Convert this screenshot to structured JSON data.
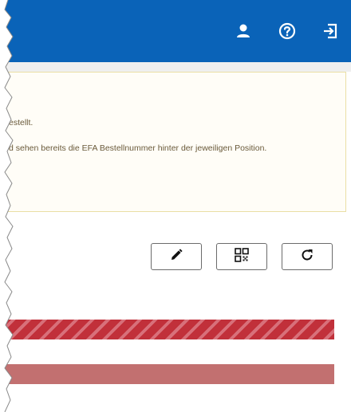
{
  "header": {
    "background": "#0a63b8",
    "icons": [
      "user-icon",
      "help-icon",
      "logout-icon"
    ]
  },
  "info_panel": {
    "line1": "estellt.",
    "line2": "d sehen bereits die EFA Bestellnummer hinter der jeweiligen Position."
  },
  "toolbar": {
    "buttons": [
      "edit-icon",
      "qr-code-icon",
      "refresh-icon"
    ]
  },
  "status_bars": {
    "striped_color": "#c1303a",
    "solid_color": "#c27070"
  }
}
